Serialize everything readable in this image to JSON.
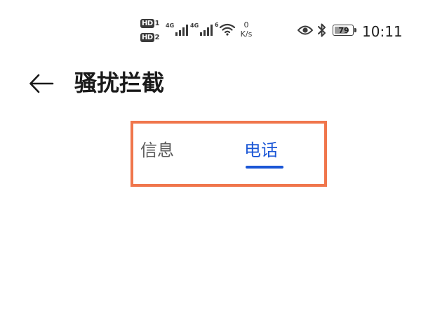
{
  "status_bar": {
    "hd1": "HD",
    "hd1_sim": "1",
    "hd2": "HD",
    "hd2_sim": "2",
    "network1": "4G",
    "network2": "4G",
    "wifi_standard": "6",
    "net_speed_value": "0",
    "net_speed_unit": "K/s",
    "battery_level": "79",
    "battery_fraction": 0.79,
    "time": "10:11",
    "icons": [
      "eye-icon",
      "bluetooth-icon",
      "battery-icon",
      "wifi-icon",
      "signal-icon"
    ]
  },
  "header": {
    "title": "骚扰拦截"
  },
  "tabs": {
    "messages": "信息",
    "calls": "电话",
    "active": "calls"
  },
  "colors": {
    "accent": "#1a56d6",
    "highlight_border": "#f0764c",
    "inactive_tab": "#5a5a5a"
  }
}
